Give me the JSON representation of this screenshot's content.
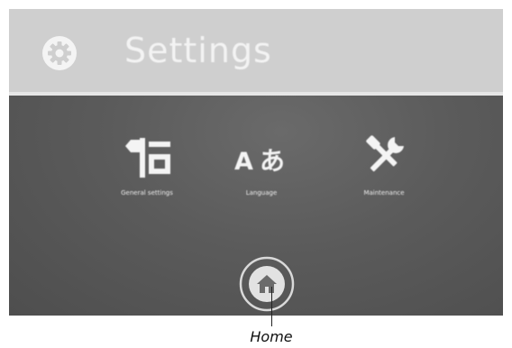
{
  "header": {
    "title": "Settings",
    "icon": "gear-icon"
  },
  "menu": {
    "items": [
      {
        "label": "General settings",
        "icon": "signpost-icon"
      },
      {
        "label": "Language",
        "icon": "language-icon",
        "glyph_latin": "A",
        "glyph_japanese": "あ"
      },
      {
        "label": "Maintenance",
        "icon": "tools-icon"
      }
    ]
  },
  "home": {
    "icon": "home-icon"
  },
  "annotation": {
    "label": "Home"
  },
  "colors": {
    "header_bg": "#cfcfcf",
    "screen_bg": "#5b5b5b",
    "text_light": "#f3f3f3"
  }
}
